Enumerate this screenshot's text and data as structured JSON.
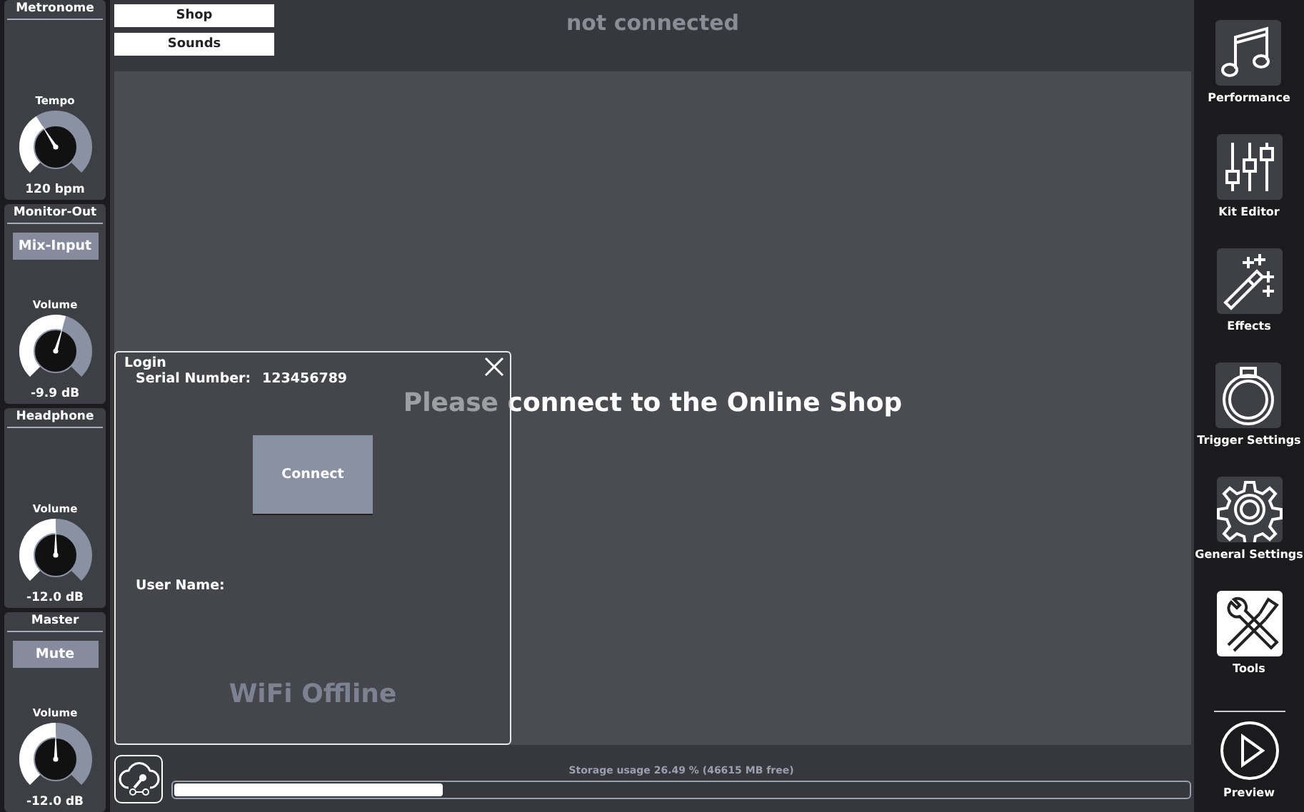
{
  "left_panels": [
    {
      "kind": "knob",
      "title": "Metronome",
      "knob_label": "Tempo",
      "level": 0.38,
      "reading": "120 bpm"
    },
    {
      "kind": "button_knob",
      "title": "Monitor-Out",
      "button": "Mix-Input",
      "knob_label": "Volume",
      "level": 0.56,
      "reading": "-9.9 dB"
    },
    {
      "kind": "knob",
      "title": "Headphone",
      "knob_label": "Volume",
      "level": 0.5,
      "reading": "-12.0 dB"
    },
    {
      "kind": "button_knob",
      "title": "Master",
      "button": "Mute",
      "knob_label": "Volume",
      "level": 0.5,
      "reading": "-12.0 dB"
    }
  ],
  "tabs": [
    "Shop",
    "Sounds"
  ],
  "status": "not connected",
  "message": "Please connect to the Online Shop",
  "login": {
    "title": "Login",
    "serial_label": "Serial Number:",
    "serial": "123456789",
    "connect": "Connect",
    "user_label": "User Name:",
    "wifi": "WiFi Offline"
  },
  "storage": {
    "label": "Storage usage 26.49 % (46615 MB free)",
    "level": 0.2649
  },
  "sidebar": [
    {
      "kind": "note",
      "label": "Performance",
      "selected": false
    },
    {
      "kind": "sliders",
      "label": "Kit Editor",
      "selected": false
    },
    {
      "kind": "wand",
      "label": "Effects",
      "selected": false
    },
    {
      "kind": "drum",
      "label": "Trigger Settings",
      "selected": false
    },
    {
      "kind": "gear",
      "label": "General Settings",
      "selected": false
    },
    {
      "kind": "tools",
      "label": "Tools",
      "selected": true
    }
  ],
  "preview": {
    "label": "Preview"
  }
}
